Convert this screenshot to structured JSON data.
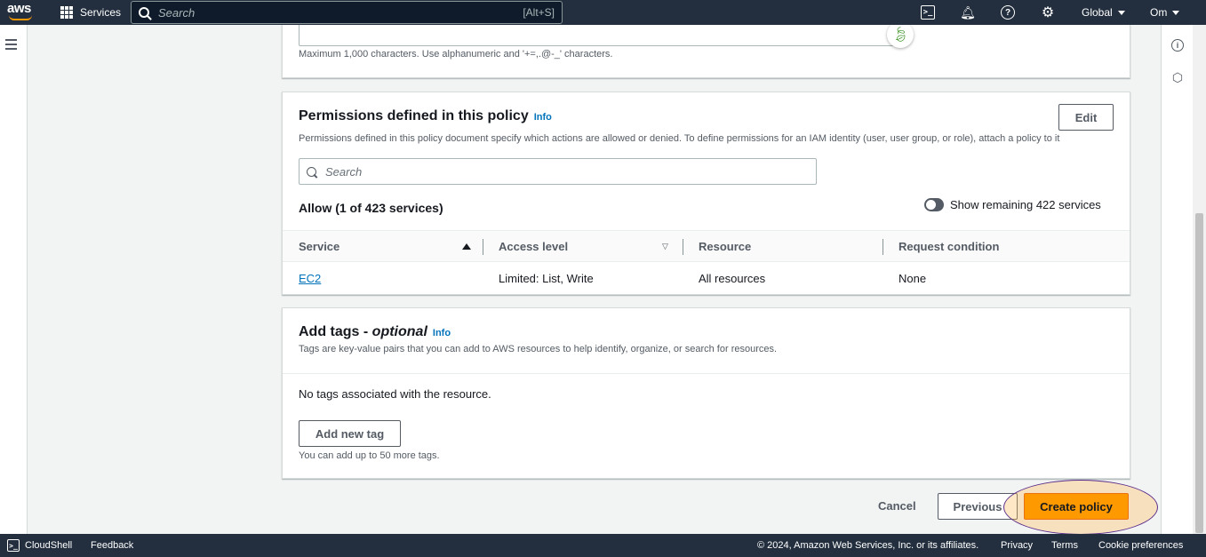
{
  "topnav": {
    "logo_text": "aws",
    "services_label": "Services",
    "search_placeholder": "Search",
    "search_shortcut": "[Alt+S]",
    "region_label": "Global",
    "account_label": "Om"
  },
  "description_field": {
    "hint": "Maximum 1,000 characters. Use alphanumeric and '+=,.@-_' characters."
  },
  "permissions": {
    "title": "Permissions defined in this policy",
    "info": "Info",
    "edit_label": "Edit",
    "description": "Permissions defined in this policy document specify which actions are allowed or denied. To define permissions for an IAM identity (user, user group, or role), attach a policy to it",
    "search_placeholder": "Search",
    "allow_title": "Allow (1 of 423 services)",
    "toggle_label": "Show remaining 422 services",
    "columns": [
      "Service",
      "Access level",
      "Resource",
      "Request condition"
    ],
    "rows": [
      {
        "service": "EC2",
        "access_level": "Limited: List, Write",
        "resource": "All resources",
        "request_condition": "None"
      }
    ]
  },
  "tags": {
    "title": "Add tags - ",
    "title_optional": "optional",
    "info": "Info",
    "description": "Tags are key-value pairs that you can add to AWS resources to help identify, organize, or search for resources.",
    "empty_text": "No tags associated with the resource.",
    "add_label": "Add new tag",
    "limit_hint": "You can add up to 50 more tags."
  },
  "actions": {
    "cancel": "Cancel",
    "previous": "Previous",
    "create": "Create policy"
  },
  "bottombar": {
    "cloudshell": "CloudShell",
    "feedback": "Feedback",
    "copyright": "© 2024, Amazon Web Services, Inc. or its affiliates.",
    "privacy": "Privacy",
    "terms": "Terms",
    "cookies": "Cookie preferences"
  },
  "colors": {
    "nav_bg": "#232f3e",
    "primary": "#ff9900",
    "link": "#0073bb",
    "highlight_ring": "#5b2d8c"
  },
  "icons": [
    "aws-logo",
    "grid-icon",
    "search-icon",
    "terminal-icon",
    "bell-icon",
    "help-icon",
    "gear-icon",
    "menu-icon",
    "info-icon",
    "hexagon-icon",
    "leaf-icon",
    "cloudshell-icon"
  ]
}
